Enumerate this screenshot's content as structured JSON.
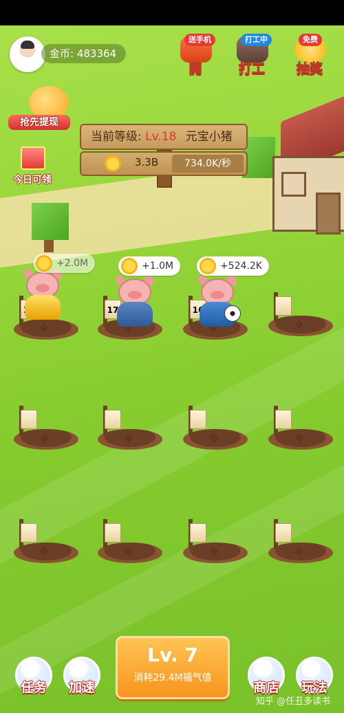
{
  "player": {
    "coins_label": "金币: 483364"
  },
  "top_buttons": [
    {
      "badge": "送手机",
      "label": "開"
    },
    {
      "badge": "打工中",
      "label": "打工"
    },
    {
      "badge": "免费",
      "label": "抽奖"
    }
  ],
  "left_buttons": {
    "withdraw": "抢先提现",
    "daily": "今日可领"
  },
  "level_sign": {
    "prefix": "当前等级: ",
    "level": "Lv.18",
    "pig_name": "元宝小猪",
    "total": "3.3B",
    "rate": "734.0K/秒"
  },
  "pigs": [
    {
      "level": "18",
      "bubble": "+2.0M",
      "color": "#f2b823"
    },
    {
      "level": "17",
      "bubble": "+1.0M",
      "color": "#3c6ca8"
    },
    {
      "level": "16",
      "bubble": "+524.2K",
      "color": "#2f6fb5"
    }
  ],
  "buy_button": {
    "level": "Lv. 7",
    "cost": "消耗29.4M福气值"
  },
  "bottom_nav": [
    {
      "label": "任务"
    },
    {
      "label": "加速"
    },
    {
      "label": "商店"
    },
    {
      "label": "玩法"
    }
  ],
  "watermark": "知乎 @任丑多读书"
}
